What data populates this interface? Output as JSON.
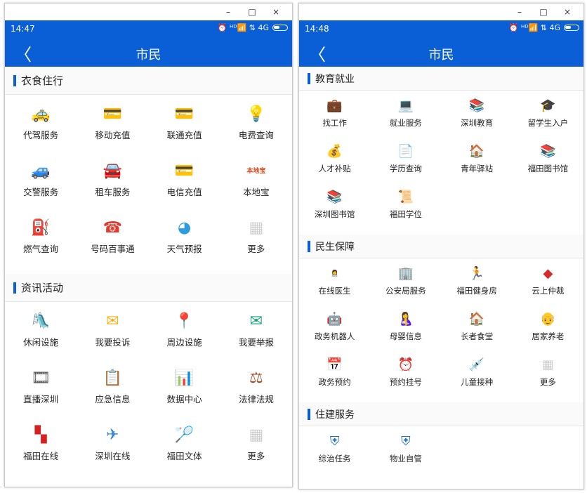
{
  "window_controls": {
    "minimize": "–",
    "maximize": "□",
    "close": "×"
  },
  "left": {
    "status": {
      "time": "14:47",
      "icons": "⏰ ᴴᴰ📶 ⇅ 4G"
    },
    "appbar": {
      "back": "〈",
      "title": "市民"
    },
    "sections": [
      {
        "title": "衣食住行",
        "items": [
          {
            "label": "代驾服务",
            "icon": "car-icon",
            "glyph": "🚕",
            "color": "#f5b400"
          },
          {
            "label": "移动充值",
            "icon": "mobile-card-icon",
            "glyph": "💳",
            "color": "#3a7fd6"
          },
          {
            "label": "联通充值",
            "icon": "unicom-card-icon",
            "glyph": "💳",
            "color": "#d62b2b"
          },
          {
            "label": "电费查询",
            "icon": "light-bulb-icon",
            "glyph": "💡",
            "color": "#f5a623"
          },
          {
            "label": "交警服务",
            "icon": "traffic-police-car-icon",
            "glyph": "🚙",
            "color": "#1f5fa8"
          },
          {
            "label": "租车服务",
            "icon": "rental-car-icon",
            "glyph": "🚘",
            "color": "#1a3d6e"
          },
          {
            "label": "电信充值",
            "icon": "telecom-card-icon",
            "glyph": "💳",
            "color": "#2e8bd6"
          },
          {
            "label": "本地宝",
            "icon": "bendibao-logo-icon",
            "glyph": "本地宝",
            "color": "#e24b1c"
          },
          {
            "label": "燃气查询",
            "icon": "gas-icon",
            "glyph": "⛽",
            "color": "#f08c00"
          },
          {
            "label": "号码百事通",
            "icon": "telephone-icon",
            "glyph": "☎",
            "color": "#e03b2f"
          },
          {
            "label": "天气预报",
            "icon": "weather-icon",
            "glyph": "◕",
            "color": "#2d9be0"
          },
          {
            "label": "更多",
            "icon": "more-grid-icon",
            "glyph": "▦",
            "color": "#cfcfcf"
          }
        ]
      },
      {
        "title": "资讯活动",
        "items": [
          {
            "label": "休闲设施",
            "icon": "playground-icon",
            "glyph": "🛝",
            "color": "#2a6bc2"
          },
          {
            "label": "我要投诉",
            "icon": "mail-complaint-icon",
            "glyph": "✉",
            "color": "#f2b21a"
          },
          {
            "label": "周边设施",
            "icon": "location-icon",
            "glyph": "📍",
            "color": "#3a88d6"
          },
          {
            "label": "我要举报",
            "icon": "report-envelope-icon",
            "glyph": "✉",
            "color": "#16a47a"
          },
          {
            "label": "直播深圳",
            "icon": "film-reel-icon",
            "glyph": "🎞",
            "color": "#555555"
          },
          {
            "label": "应急信息",
            "icon": "emergency-doc-icon",
            "glyph": "📋",
            "color": "#d6453b"
          },
          {
            "label": "数据中心",
            "icon": "data-chart-icon",
            "glyph": "📊",
            "color": "#3a88d6"
          },
          {
            "label": "法律法规",
            "icon": "gavel-icon",
            "glyph": "⚖",
            "color": "#a0522d"
          },
          {
            "label": "福田在线",
            "icon": "futian-logo-icon",
            "glyph": "▚",
            "color": "#d61f1f"
          },
          {
            "label": "深圳在线",
            "icon": "shenzhen-online-icon",
            "glyph": "✈",
            "color": "#3a88d6"
          },
          {
            "label": "福田文体",
            "icon": "badminton-icon",
            "glyph": "🏸",
            "color": "#2d6ab8"
          },
          {
            "label": "更多",
            "icon": "more-grid-icon",
            "glyph": "▦",
            "color": "#cfcfcf"
          }
        ]
      }
    ]
  },
  "right": {
    "status": {
      "time": "14:48",
      "icons": "⏰ ᴴᴰ📶 ⇅ 4G"
    },
    "appbar": {
      "back": "〈",
      "title": "市民"
    },
    "sections": [
      {
        "title": "教育就业",
        "items": [
          {
            "label": "找工作",
            "icon": "briefcase-icon",
            "glyph": "💼",
            "color": "#1f6fc7"
          },
          {
            "label": "就业服务",
            "icon": "computer-icon",
            "glyph": "💻",
            "color": "#3a88d6"
          },
          {
            "label": "深圳教育",
            "icon": "books-icon",
            "glyph": "📚",
            "color": "#2ea56a"
          },
          {
            "label": "留学生入户",
            "icon": "graduation-cap-icon",
            "glyph": "🎓",
            "color": "#333333"
          },
          {
            "label": "人才补贴",
            "icon": "coins-person-icon",
            "glyph": "💰",
            "color": "#f2b21a"
          },
          {
            "label": "学历查询",
            "icon": "document-list-icon",
            "glyph": "📄",
            "color": "#2e8bd6"
          },
          {
            "label": "青年驿站",
            "icon": "house-icon",
            "glyph": "🏠",
            "color": "#333333"
          },
          {
            "label": "福田图书馆",
            "icon": "library-books-icon",
            "glyph": "📚",
            "color": "#2ea56a"
          },
          {
            "label": "深圳图书馆",
            "icon": "bookshelf-icon",
            "glyph": "📚",
            "color": "#c0392b"
          },
          {
            "label": "福田学位",
            "icon": "certificate-icon",
            "glyph": "📜",
            "color": "#3a88d6"
          }
        ]
      },
      {
        "title": "民生保障",
        "items": [
          {
            "label": "在线医生",
            "icon": "doctor-icon",
            "glyph": "👩‍⚕",
            "color": "#3a88d6"
          },
          {
            "label": "公安局服务",
            "icon": "police-building-icon",
            "glyph": "🏢",
            "color": "#1f5fa8"
          },
          {
            "label": "福田健身房",
            "icon": "running-person-icon",
            "glyph": "🏃",
            "color": "#2d6ab8"
          },
          {
            "label": "云上仲裁",
            "icon": "arbitration-logo-icon",
            "glyph": "◆",
            "color": "#d62b2b"
          },
          {
            "label": "政务机器人",
            "icon": "robot-icon",
            "glyph": "🤖",
            "color": "#e07b2f"
          },
          {
            "label": "母婴信息",
            "icon": "mother-baby-icon",
            "glyph": "🤱",
            "color": "#f2b21a"
          },
          {
            "label": "长者食堂",
            "icon": "canteen-house-icon",
            "glyph": "🏠",
            "color": "#e24b1c"
          },
          {
            "label": "居家养老",
            "icon": "elderly-couple-icon",
            "glyph": "👴",
            "color": "#8a6d3b"
          },
          {
            "label": "政务预约",
            "icon": "calendar-icon",
            "glyph": "📅",
            "color": "#e85c5c"
          },
          {
            "label": "预约挂号",
            "icon": "clock-calendar-icon",
            "glyph": "⏰",
            "color": "#d62b2b"
          },
          {
            "label": "儿童接种",
            "icon": "syringe-icon",
            "glyph": "💉",
            "color": "#2ea56a"
          },
          {
            "label": "更多",
            "icon": "more-grid-icon",
            "glyph": "▦",
            "color": "#cfcfcf"
          }
        ]
      },
      {
        "title": "住建服务",
        "items": [
          {
            "label": "综治任务",
            "icon": "shield-plus-icon",
            "glyph": "⛨",
            "color": "#1f6fc7"
          },
          {
            "label": "物业自管",
            "icon": "shield-home-icon",
            "glyph": "⛨",
            "color": "#1f6fc7"
          }
        ]
      }
    ]
  }
}
